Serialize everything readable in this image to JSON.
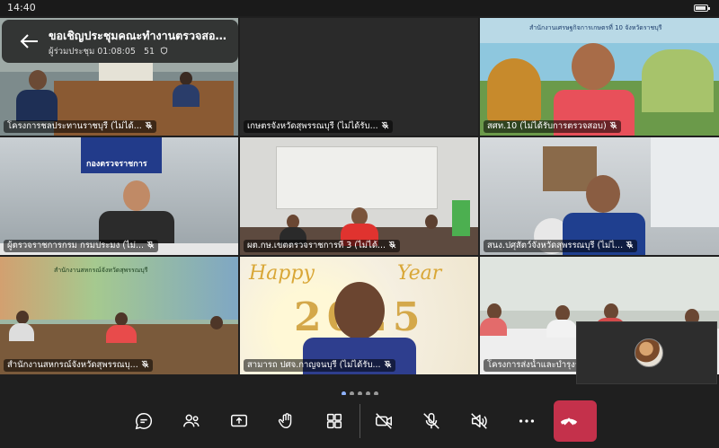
{
  "status_bar": {
    "time": "14:40"
  },
  "meeting": {
    "title": "ขอเชิญประชุมคณะทำงานตรวจสอบ...",
    "subtitle_prefix": "ผู้ร่วมประชุม",
    "elapsed": "01:08:05",
    "participant_count": "51"
  },
  "tiles": [
    {
      "label": "โครงการชลประทานราชบุรี (ไม่ได้..."
    },
    {
      "label": "เกษตรจังหวัดสุพรรณบุรี (ไม่ได้รับ..."
    },
    {
      "label": "สศท.10 (ไม่ได้รับการตรวจสอบ)"
    },
    {
      "label": "ผู้ตรวจราชการกรม กรมประมง (ไม่..."
    },
    {
      "label": "ผต.กษ.เขตตรวจราชการที่ 3 (ไม่ได้..."
    },
    {
      "label": "สนง.ปศุสัตว์จังหวัดสุพรรณบุรี (ไม่ไ..."
    },
    {
      "label": "สำนักงานสหกรณ์จังหวัดสุพรรณบุ..."
    },
    {
      "label": "สามารถ ปศจ.กาญจนบุรี (ไม่ได้รับ..."
    },
    {
      "label": "โครงการส่งน้ำและบำรุงรักษาสามชุ..."
    }
  ],
  "scene_text": {
    "banner_tile4": "กองตรวจราชการ",
    "banner_tile3": "สำนักงานเศรษฐกิจการเกษตรที่ 10 จังหวัดราชบุรี",
    "banner_tile7": "สำนักงานสหกรณ์จังหวัดสุพรรณบุรี",
    "newyear_word1": "Happy",
    "newyear_word2": "Year",
    "newyear_number": "2025"
  },
  "pager": {
    "pages": 5,
    "active": 0
  },
  "toolbar": {
    "chat": "chat-icon",
    "participants": "people-icon",
    "share": "share-screen-icon",
    "react": "raise-hand-icon",
    "view": "grid-view-icon",
    "camera": "camera-off-icon",
    "mic": "mic-off-icon",
    "speaker": "speaker-off-icon",
    "more": "more-icon",
    "leave": "hang-up-icon"
  },
  "colors": {
    "leave_red": "#c4314b",
    "pager_active": "#8fb3ff"
  }
}
